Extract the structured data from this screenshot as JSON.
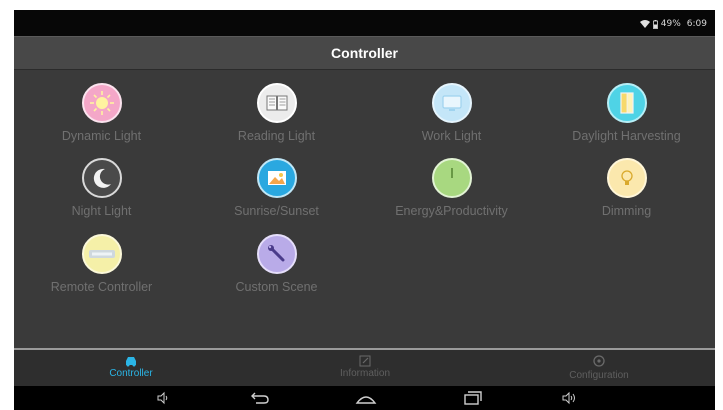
{
  "status_bar": {
    "battery_text": "49%",
    "time": "6:09"
  },
  "app_bar": {
    "title": "Controller"
  },
  "tiles": [
    {
      "label": "Dynamic Light",
      "icon": "sun-icon",
      "color": "#f4a7c8"
    },
    {
      "label": "Reading Light",
      "icon": "book-icon",
      "color": "#e8e8e8"
    },
    {
      "label": "Work Light",
      "icon": "monitor-icon",
      "color": "#bfe3f7"
    },
    {
      "label": "Daylight Harvesting",
      "icon": "window-icon",
      "color": "#4fd3e6"
    },
    {
      "label": "Night Light",
      "icon": "moon-icon",
      "color": "#444444"
    },
    {
      "label": "Sunrise/Sunset",
      "icon": "sunrise-icon",
      "color": "#2aa8e0"
    },
    {
      "label": "Energy&Productivity",
      "icon": "clock-icon",
      "color": "#a8d880"
    },
    {
      "label": "Dimming",
      "icon": "bulb-icon",
      "color": "#fbe5a4"
    },
    {
      "label": "Remote Controller",
      "icon": "remote-icon",
      "color": "#f5f0a0"
    },
    {
      "label": "Custom Scene",
      "icon": "wrench-icon",
      "color": "#b8a9e6"
    }
  ],
  "bottom_nav": [
    {
      "label": "Controller",
      "icon": "car-icon",
      "active": true
    },
    {
      "label": "Information",
      "icon": "edit-icon",
      "active": false
    },
    {
      "label": "Configuration",
      "icon": "gear-icon",
      "active": false
    }
  ],
  "colors": {
    "accent": "#2bb5e6",
    "inactive": "#666666",
    "label": "#707070"
  }
}
